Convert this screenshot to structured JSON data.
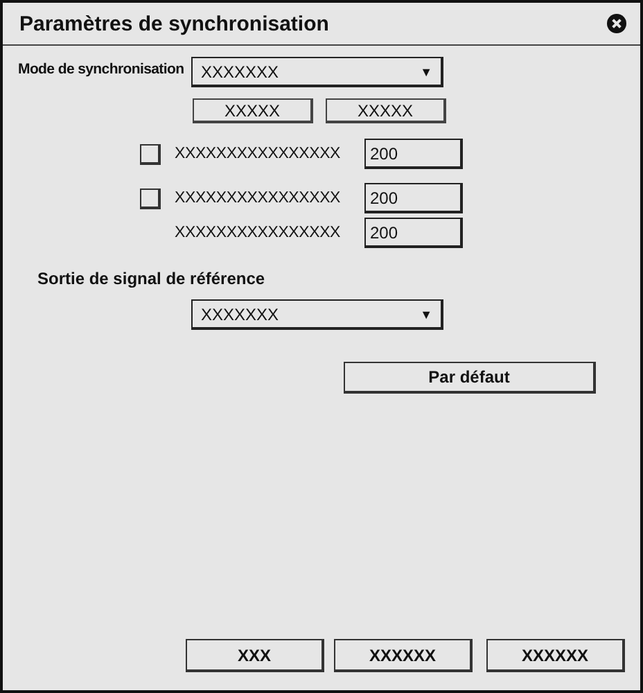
{
  "window": {
    "title": "Paramètres de synchronisation"
  },
  "sync_mode": {
    "label": "Mode de synchronisation",
    "value": "XXXXXXX",
    "arrow": "▼",
    "buttons": [
      "XXXXX",
      "XXXXX"
    ]
  },
  "rows": [
    {
      "kind": "checkbox",
      "checked": false,
      "label": "XXXXXXXXXXXXXXXX",
      "value": "200"
    },
    {
      "kind": "checkbox",
      "checked": false,
      "label": "XXXXXXXXXXXXXXXX",
      "value": "200"
    },
    {
      "kind": "plain",
      "label": "XXXXXXXXXXXXXXXX",
      "value": "200"
    }
  ],
  "reference_output": {
    "label": "Sortie de signal de référence",
    "value": "XXXXXXX",
    "arrow": "▼"
  },
  "default_button": "Par défaut",
  "footer_buttons": [
    "XXX",
    "XXXXXX",
    "XXXXXX"
  ]
}
